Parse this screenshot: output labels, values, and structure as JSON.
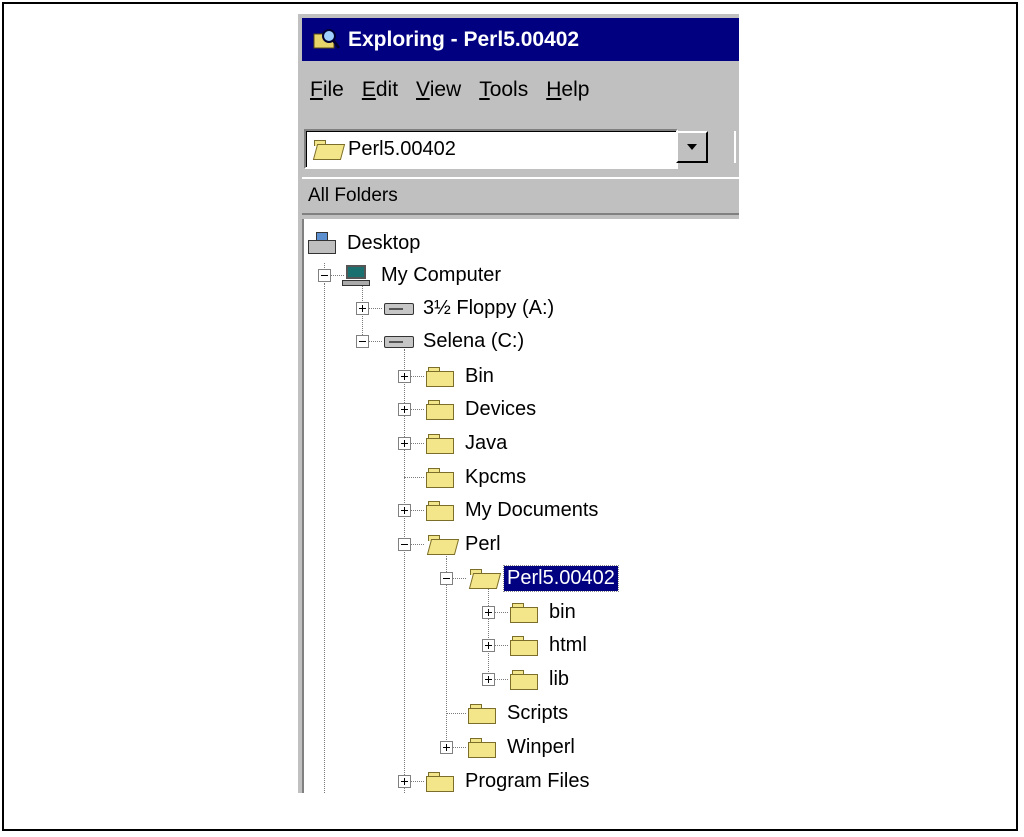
{
  "window": {
    "title": "Exploring - Perl5.00402"
  },
  "menu": [
    {
      "key": "F",
      "rest": "ile"
    },
    {
      "key": "E",
      "rest": "dit"
    },
    {
      "key": "V",
      "rest": "iew"
    },
    {
      "key": "T",
      "rest": "ools"
    },
    {
      "key": "H",
      "rest": "elp"
    }
  ],
  "address": {
    "value": "Perl5.00402"
  },
  "pane": {
    "header": "All Folders"
  },
  "tree": {
    "desktop": "Desktop",
    "my_computer": "My Computer",
    "floppy": "3½ Floppy (A:)",
    "drive_c": "Selena (C:)",
    "bin": "Bin",
    "devices": "Devices",
    "java": "Java",
    "kpcms": "Kpcms",
    "my_documents": "My Documents",
    "perl": "Perl",
    "perl5": "Perl5.00402",
    "perl5_bin": "bin",
    "perl5_html": "html",
    "perl5_lib": "lib",
    "scripts": "Scripts",
    "winperl": "Winperl",
    "program_files": "Program Files"
  }
}
